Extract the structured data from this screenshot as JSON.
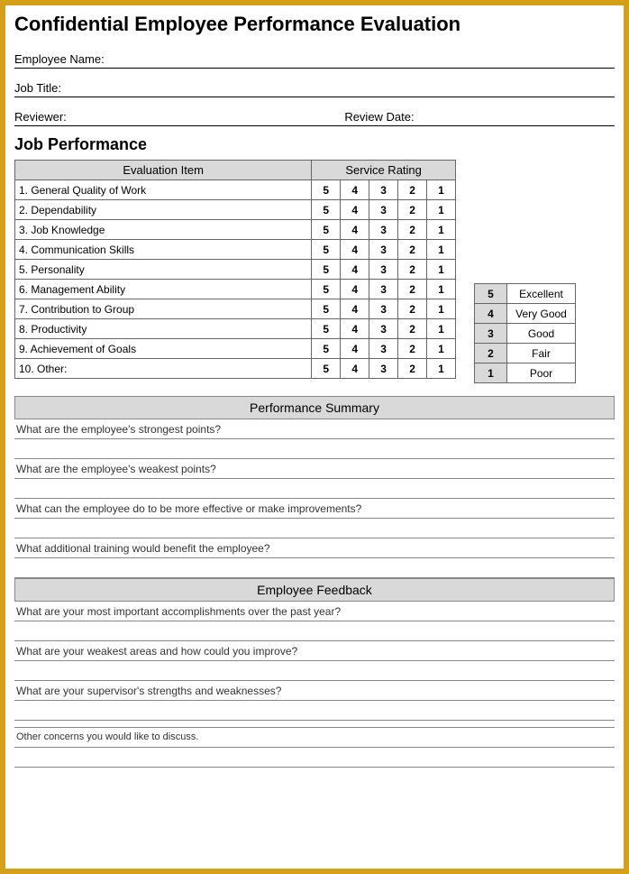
{
  "title": "Confidential Employee Performance Evaluation",
  "fields": {
    "employee_name_label": "Employee Name:",
    "job_title_label": "Job Title:",
    "reviewer_label": "Reviewer:",
    "review_date_label": "Review Date:"
  },
  "job_performance": {
    "heading": "Job Performance",
    "eval_header": "Evaluation  Item",
    "rating_header": "Service Rating",
    "items": [
      "1.  General Quality of Work",
      "2.  Dependability",
      "3.  Job Knowledge",
      "4.  Communication Skills",
      "5.  Personality",
      "6.  Management Ability",
      "7.  Contribution to Group",
      "8.  Productivity",
      "9.  Achievement of Goals",
      "10. Other:"
    ],
    "ratings": [
      "5",
      "4",
      "3",
      "2",
      "1"
    ]
  },
  "legend": [
    {
      "num": "5",
      "label": "Excellent"
    },
    {
      "num": "4",
      "label": "Very Good"
    },
    {
      "num": "3",
      "label": "Good"
    },
    {
      "num": "2",
      "label": "Fair"
    },
    {
      "num": "1",
      "label": "Poor"
    }
  ],
  "summary": {
    "header": "Performance Summary",
    "q1": "What are the employee's strongest points?",
    "q2": "What are the employee's weakest points?",
    "q3": "What can the employee do to be more effective or make improvements?",
    "q4": "What additional training would benefit the employee?"
  },
  "feedback": {
    "header": "Employee Feedback",
    "q1": "What are your most important accomplishments over the past year?",
    "q2": "What are your weakest areas and how could you improve?",
    "q3": "What are your supervisor's strengths and weaknesses?",
    "q4": "Other concerns you would like to discuss."
  }
}
